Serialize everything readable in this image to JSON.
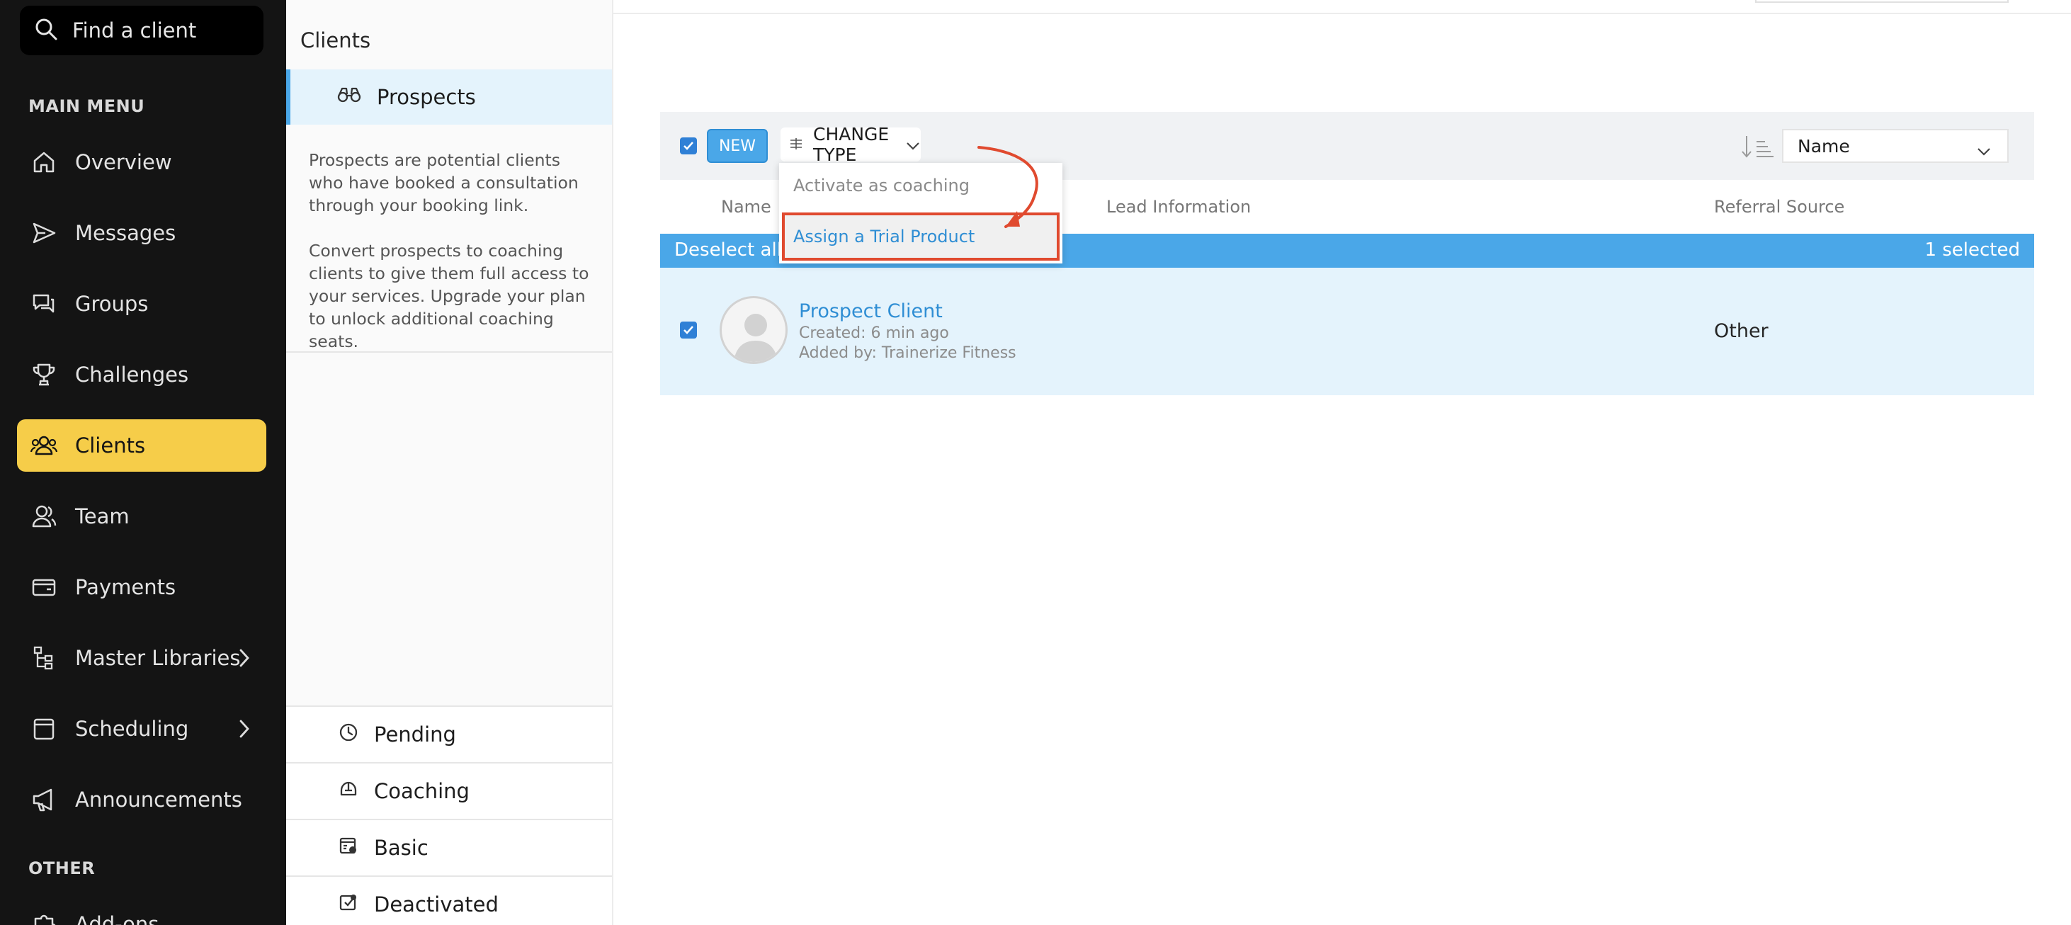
{
  "search": {
    "placeholder": "Find a client",
    "icon": "search-icon"
  },
  "nav": {
    "main_heading": "MAIN MENU",
    "items": [
      {
        "label": "Overview",
        "icon": "home-icon"
      },
      {
        "label": "Messages",
        "icon": "send-icon"
      },
      {
        "label": "Groups",
        "icon": "chat-bubbles-icon"
      },
      {
        "label": "Challenges",
        "icon": "trophy-icon"
      },
      {
        "label": "Clients",
        "icon": "users-icon",
        "active": true
      },
      {
        "label": "Team",
        "icon": "team-icon"
      },
      {
        "label": "Payments",
        "icon": "wallet-icon"
      },
      {
        "label": "Master Libraries",
        "icon": "tree-icon",
        "has_children": true
      },
      {
        "label": "Scheduling",
        "icon": "calendar-icon",
        "has_children": true
      },
      {
        "label": "Announcements",
        "icon": "megaphone-icon"
      }
    ],
    "other_heading": "OTHER",
    "other_items": [
      {
        "label": "Add-ons",
        "icon": "puzzle-icon"
      }
    ],
    "active_color": "#f6cd49"
  },
  "sidebar": {
    "title": "Clients",
    "active_item": {
      "label": "Prospects",
      "icon": "binoculars-icon"
    },
    "description_1": "Prospects are potential clients who have booked a consultation through your booking link.",
    "description_2": "Convert prospects to coaching clients to give them full access to your services. Upgrade your plan to unlock additional coaching seats.",
    "links": [
      {
        "label": "Pending",
        "icon": "clock-icon"
      },
      {
        "label": "Coaching",
        "icon": "helmet-icon"
      },
      {
        "label": "Basic",
        "icon": "calendar-check-icon"
      },
      {
        "label": "Deactivated",
        "icon": "deactivated-icon"
      }
    ]
  },
  "toolbar": {
    "new_label": "NEW",
    "change_type_label": "CHANGE TYPE",
    "sort_value": "Name"
  },
  "dropdown": {
    "items": [
      "Activate as coaching",
      "Assign a Trial Product"
    ],
    "highlighted": "Assign a Trial Product"
  },
  "table": {
    "columns": [
      "Name",
      "Lead Information",
      "Referral Source"
    ],
    "deselect_label": "Deselect all",
    "selected_count": "1 selected",
    "rows": [
      {
        "name": "Prospect Client",
        "created": "Created: 6 min ago",
        "added_by": "Added by: Trainerize Fitness",
        "referral_source": "Other"
      }
    ]
  },
  "colors": {
    "accent": "#4aa7e8",
    "highlight_border": "#e04a2f",
    "nav_bg": "#141414"
  }
}
